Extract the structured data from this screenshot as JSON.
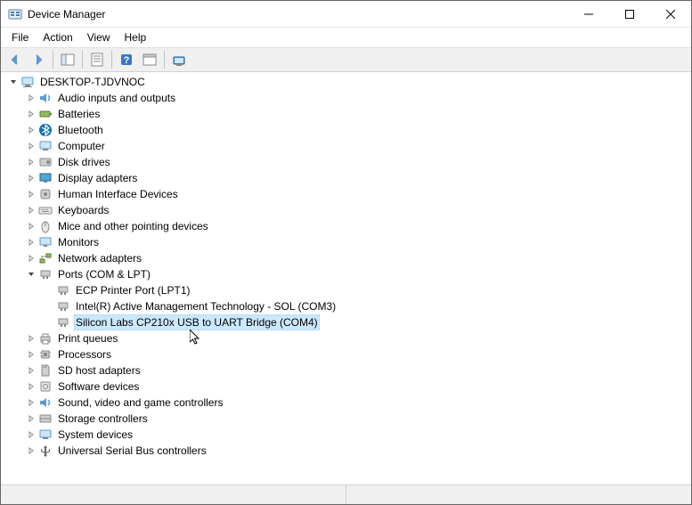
{
  "window": {
    "title": "Device Manager"
  },
  "menubar": [
    "File",
    "Action",
    "View",
    "Help"
  ],
  "tree": {
    "root": "DESKTOP-TJDVNOC",
    "nodes": [
      {
        "label": "Audio inputs and outputs",
        "icon": "audio",
        "expandable": true
      },
      {
        "label": "Batteries",
        "icon": "battery",
        "expandable": true
      },
      {
        "label": "Bluetooth",
        "icon": "bluetooth",
        "expandable": true
      },
      {
        "label": "Computer",
        "icon": "computer",
        "expandable": true
      },
      {
        "label": "Disk drives",
        "icon": "disk",
        "expandable": true
      },
      {
        "label": "Display adapters",
        "icon": "display",
        "expandable": true
      },
      {
        "label": "Human Interface Devices",
        "icon": "hid",
        "expandable": true
      },
      {
        "label": "Keyboards",
        "icon": "keyboard",
        "expandable": true
      },
      {
        "label": "Mice and other pointing devices",
        "icon": "mouse",
        "expandable": true
      },
      {
        "label": "Monitors",
        "icon": "monitor",
        "expandable": true
      },
      {
        "label": "Network adapters",
        "icon": "network",
        "expandable": true
      },
      {
        "label": "Ports (COM & LPT)",
        "icon": "port",
        "expandable": true,
        "expanded": true,
        "children": [
          {
            "label": "ECP Printer Port (LPT1)",
            "icon": "port-item"
          },
          {
            "label": "Intel(R) Active Management Technology - SOL (COM3)",
            "icon": "port-item"
          },
          {
            "label": "Silicon Labs CP210x USB to UART Bridge (COM4)",
            "icon": "port-item",
            "selected": true
          }
        ]
      },
      {
        "label": "Print queues",
        "icon": "printer",
        "expandable": true
      },
      {
        "label": "Processors",
        "icon": "cpu",
        "expandable": true
      },
      {
        "label": "SD host adapters",
        "icon": "sd",
        "expandable": true
      },
      {
        "label": "Software devices",
        "icon": "software",
        "expandable": true
      },
      {
        "label": "Sound, video and game controllers",
        "icon": "sound",
        "expandable": true
      },
      {
        "label": "Storage controllers",
        "icon": "storage",
        "expandable": true
      },
      {
        "label": "System devices",
        "icon": "system",
        "expandable": true
      },
      {
        "label": "Universal Serial Bus controllers",
        "icon": "usb",
        "expandable": true
      }
    ]
  }
}
